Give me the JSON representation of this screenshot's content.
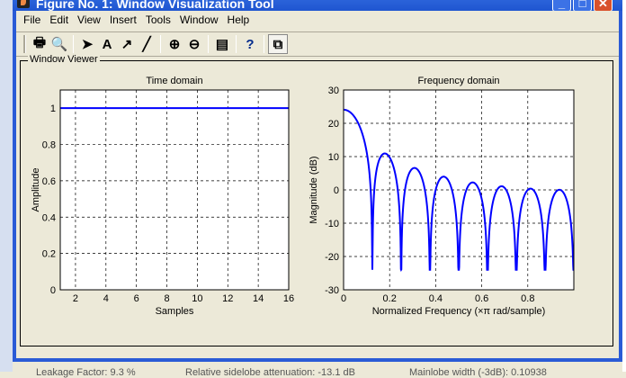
{
  "window": {
    "title": "Figure No. 1: Window Visualization Tool",
    "controls": [
      "minimize",
      "maximize",
      "close"
    ]
  },
  "menu": [
    "File",
    "Edit",
    "View",
    "Insert",
    "Tools",
    "Window",
    "Help"
  ],
  "toolbar": [
    {
      "icon": "print-icon",
      "glyph": "🖶"
    },
    {
      "icon": "print-preview-icon",
      "glyph": "🔍"
    },
    {
      "sep": true
    },
    {
      "icon": "select-arrow-icon",
      "glyph": "➤"
    },
    {
      "icon": "insert-text-icon",
      "glyph": "A"
    },
    {
      "icon": "insert-arrow-icon",
      "glyph": "↗"
    },
    {
      "icon": "insert-line-icon",
      "glyph": "╱"
    },
    {
      "sep": true
    },
    {
      "icon": "zoom-in-icon",
      "glyph": "⊕"
    },
    {
      "icon": "zoom-out-icon",
      "glyph": "⊖"
    },
    {
      "sep": true
    },
    {
      "icon": "window-analysis-icon",
      "glyph": "▤"
    },
    {
      "sep": true
    },
    {
      "icon": "whats-this-icon",
      "glyph": "?"
    },
    {
      "sep": true
    },
    {
      "icon": "new-window-icon",
      "glyph": "⧉",
      "pressed": true
    }
  ],
  "panel": {
    "title": "Window Viewer"
  },
  "status": {
    "leakage": "Leakage Factor: 9.3 %",
    "sidelobe": "Relative sidelobe attenuation: -13.1 dB",
    "mainlobe": "Mainlobe width (-3dB): 0.10938"
  },
  "colors": {
    "line": "#0000ff"
  },
  "chart_data": [
    {
      "type": "line",
      "title": "Time domain",
      "xlabel": "Samples",
      "ylabel": "Amplitude",
      "x": [
        1,
        2,
        3,
        4,
        5,
        6,
        7,
        8,
        9,
        10,
        11,
        12,
        13,
        14,
        15,
        16
      ],
      "y": [
        1,
        1,
        1,
        1,
        1,
        1,
        1,
        1,
        1,
        1,
        1,
        1,
        1,
        1,
        1,
        1
      ],
      "xlim": [
        1,
        16
      ],
      "ylim": [
        0,
        1.1
      ],
      "xticks": [
        2,
        4,
        6,
        8,
        10,
        12,
        14,
        16
      ],
      "yticks": [
        0,
        0.2,
        0.4,
        0.6,
        0.8,
        1
      ],
      "grid": true
    },
    {
      "type": "line",
      "title": "Frequency domain",
      "xlabel": "Normalized Frequency  (×π rad/sample)",
      "ylabel": "Magnitude (dB)",
      "window_length": 16,
      "peak_db": 24.08,
      "nulls": [
        0.125,
        0.25,
        0.375,
        0.5,
        0.625,
        0.75,
        0.875
      ],
      "xlim": [
        0,
        1
      ],
      "ylim": [
        -30,
        30
      ],
      "xticks": [
        0,
        0.2,
        0.4,
        0.6,
        0.8
      ],
      "yticks": [
        -30,
        -20,
        -10,
        0,
        10,
        20,
        30
      ],
      "grid": true
    }
  ]
}
